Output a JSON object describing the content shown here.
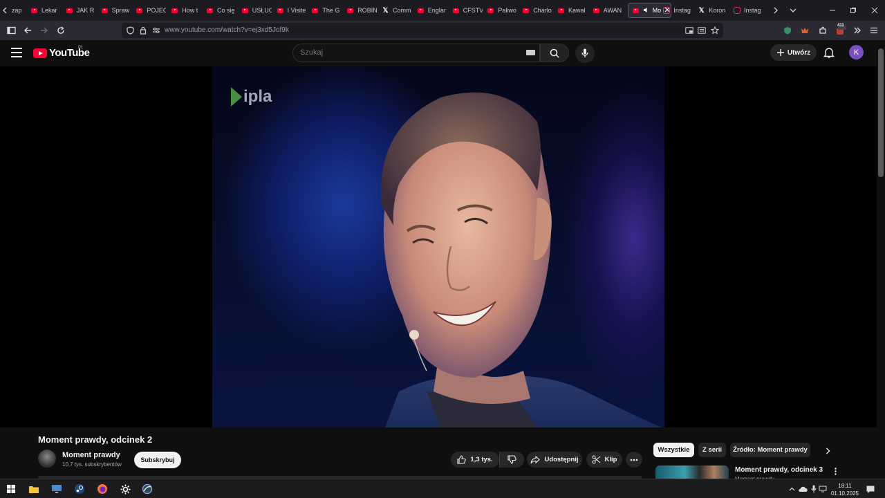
{
  "browser": {
    "tabs": [
      {
        "label": "zap",
        "favicon": "generic"
      },
      {
        "label": "Lekar",
        "favicon": "youtube-icon"
      },
      {
        "label": "JAK R",
        "favicon": "youtube-icon"
      },
      {
        "label": "Spraw",
        "favicon": "youtube-icon"
      },
      {
        "label": "POJEC",
        "favicon": "youtube-icon"
      },
      {
        "label": "How t",
        "favicon": "youtube-icon"
      },
      {
        "label": "Co się",
        "favicon": "youtube-icon"
      },
      {
        "label": "USŁUC",
        "favicon": "youtube-icon"
      },
      {
        "label": "I Visite",
        "favicon": "youtube-icon"
      },
      {
        "label": "The G",
        "favicon": "youtube-icon"
      },
      {
        "label": "ROBIN",
        "favicon": "youtube-icon"
      },
      {
        "label": "Comm",
        "favicon": "x-icon"
      },
      {
        "label": "Englar",
        "favicon": "youtube-icon"
      },
      {
        "label": "CFSTV",
        "favicon": "youtube-icon"
      },
      {
        "label": "Paliwo",
        "favicon": "youtube-icon"
      },
      {
        "label": "Charlo",
        "favicon": "youtube-icon"
      },
      {
        "label": "Kawal",
        "favicon": "youtube-icon"
      },
      {
        "label": "AWAN",
        "favicon": "youtube-icon"
      },
      {
        "label": "Mo",
        "favicon": "youtube-icon"
      },
      {
        "label": "Instag",
        "favicon": "instagram-icon"
      },
      {
        "label": "Koron",
        "favicon": "x-icon"
      },
      {
        "label": "Instag",
        "favicon": "instagram-icon"
      }
    ],
    "active_tab_index": 18,
    "url": "www.youtube.com/watch?v=ej3xd5Jof9k",
    "extension_badge": "411"
  },
  "youtube": {
    "logo_text": "YouTube",
    "country_code": "PL",
    "search_placeholder": "Szukaj",
    "create_label": "Utwórz",
    "avatar_letter": "K",
    "avatar_color": "#7b4fc4"
  },
  "video": {
    "overlay_logo": "ipla",
    "title": "Moment prawdy, odcinek 2",
    "channel_name": "Moment prawdy",
    "subscribers": "10,7 tys. subskrybentów",
    "subscribe_label": "Subskrybuj",
    "likes": "1,3 tys.",
    "share_label": "Udostępnij",
    "clip_label": "Klip"
  },
  "recommendations": {
    "chips": [
      "Wszystkie",
      "Z serii",
      "Źródło: Moment prawdy"
    ],
    "selected_chip": 0,
    "first_item": {
      "title": "Moment prawdy, odcinek 3",
      "channel": "Moment prawdy"
    }
  },
  "taskbar": {
    "time": "18:11",
    "date": "01.10.2025"
  }
}
